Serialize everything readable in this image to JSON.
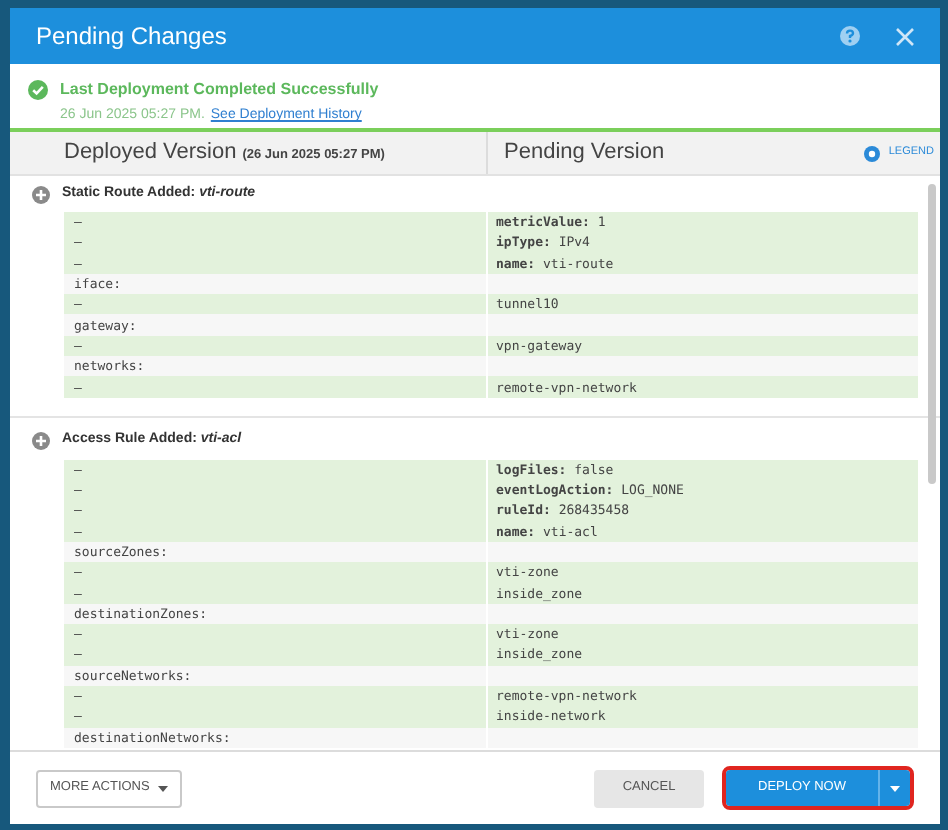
{
  "dialog": {
    "title": "Pending Changes"
  },
  "status": {
    "title": "Last Deployment Completed Successfully",
    "date": "26 Jun 2025 05:27 PM.",
    "link": "See Deployment History"
  },
  "columns": {
    "deployed_label": "Deployed Version",
    "deployed_date": "(26 Jun 2025 05:27 PM)",
    "pending_label": "Pending Version",
    "legend": "LEGEND"
  },
  "sections": [
    {
      "title": "Static Route Added: *vti-route*",
      "expanded": true,
      "rows": [
        {
          "kind": "added",
          "left": "–",
          "right": "**metricValue:** 1"
        },
        {
          "kind": "added",
          "left": "–",
          "right": "**ipType:** IPv4"
        },
        {
          "kind": "added",
          "left": "–",
          "right": "**name:** vti-route"
        },
        {
          "kind": "context",
          "left": "iface:",
          "right": ""
        },
        {
          "kind": "added",
          "left": "–",
          "right": "tunnel10"
        },
        {
          "kind": "context",
          "left": "gateway:",
          "right": ""
        },
        {
          "kind": "added",
          "left": "–",
          "right": "vpn-gateway"
        },
        {
          "kind": "context",
          "left": "networks:",
          "right": ""
        },
        {
          "kind": "added",
          "left": "–",
          "right": "remote-vpn-network"
        }
      ]
    },
    {
      "title": "Access Rule Added: *vti-acl*",
      "expanded": true,
      "rows": [
        {
          "kind": "added",
          "left": "–",
          "right": "**logFiles:** false"
        },
        {
          "kind": "added",
          "left": "–",
          "right": "**eventLogAction:** LOG_NONE"
        },
        {
          "kind": "added",
          "left": "–",
          "right": "**ruleId:** 268435458"
        },
        {
          "kind": "added",
          "left": "–",
          "right": "**name:** vti-acl"
        },
        {
          "kind": "context",
          "left": "sourceZones:",
          "right": ""
        },
        {
          "kind": "added",
          "left": "–",
          "right": "vti-zone"
        },
        {
          "kind": "added",
          "left": "–",
          "right": "inside_zone"
        },
        {
          "kind": "context",
          "left": "destinationZones:",
          "right": ""
        },
        {
          "kind": "added",
          "left": "–",
          "right": "vti-zone"
        },
        {
          "kind": "added",
          "left": "–",
          "right": "inside_zone"
        },
        {
          "kind": "context",
          "left": "sourceNetworks:",
          "right": ""
        },
        {
          "kind": "added",
          "left": "–",
          "right": "remote-vpn-network"
        },
        {
          "kind": "added",
          "left": "–",
          "right": "inside-network"
        },
        {
          "kind": "context",
          "left": "destinationNetworks:",
          "right": ""
        }
      ]
    }
  ],
  "footer": {
    "more_actions": "MORE ACTIONS",
    "cancel": "CANCEL",
    "deploy": "DEPLOY NOW"
  }
}
